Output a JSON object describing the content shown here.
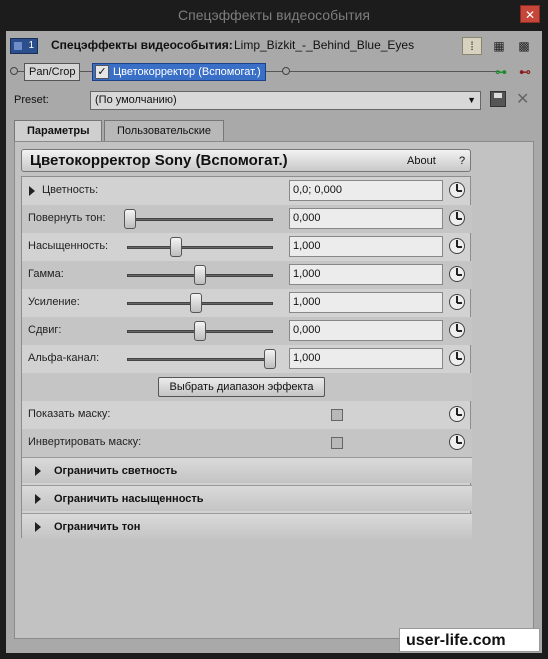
{
  "window": {
    "title": "Спецэффекты видеособытия",
    "close_symbol": "✕"
  },
  "header": {
    "media_badge": "1",
    "fx_title": "Спецэффекты видеособытия:",
    "file_name": "Limp_Bizkit_-_Behind_Blue_Eyes",
    "view_icons": [
      "view-list-icon",
      "view-grid-icon",
      "view-grid-large-icon"
    ]
  },
  "chain": {
    "plugins": [
      {
        "label": "Pan/Crop",
        "active": false
      },
      {
        "label": "Цветокорректор (Вспомогат.)",
        "active": true
      }
    ],
    "check_symbol": "✓",
    "plug_icons": [
      "plug-chain-icon",
      "plug-remove-icon"
    ],
    "plug_symbols": [
      "⊶",
      "⊷"
    ]
  },
  "preset": {
    "label": "Preset:",
    "value": "(По умолчанию)",
    "arrow": "▼",
    "delete_symbol": "✕"
  },
  "tabs": [
    {
      "label": "Параметры",
      "active": true
    },
    {
      "label": "Пользовательские",
      "active": false
    }
  ],
  "plugin": {
    "title": "Цветокорректор Sony (Вспомогат.)",
    "about": "About",
    "help": "?",
    "params": [
      {
        "label": "Цветность:",
        "value": "0,0; 0,000",
        "slider": null,
        "expander": true
      },
      {
        "label": "Повернуть тон:",
        "value": "0,000",
        "slider": 0.0
      },
      {
        "label": "Насыщенность:",
        "value": "1,000",
        "slider": 0.33
      },
      {
        "label": "Гамма:",
        "value": "1,000",
        "slider": 0.5
      },
      {
        "label": "Усиление:",
        "value": "1,000",
        "slider": 0.47
      },
      {
        "label": "Сдвиг:",
        "value": "0,000",
        "slider": 0.5
      },
      {
        "label": "Альфа-канал:",
        "value": "1,000",
        "slider": 1.0
      }
    ],
    "range_button": "Выбрать диапазон эффекта",
    "checkboxes": [
      {
        "label": "Показать маску:",
        "checked": false
      },
      {
        "label": "Инвертировать маску:",
        "checked": false
      }
    ],
    "sections": [
      {
        "label": "Ограничить светность"
      },
      {
        "label": "Ограничить насыщенность"
      },
      {
        "label": "Ограничить тон"
      }
    ]
  },
  "watermark": "user-life.com"
}
